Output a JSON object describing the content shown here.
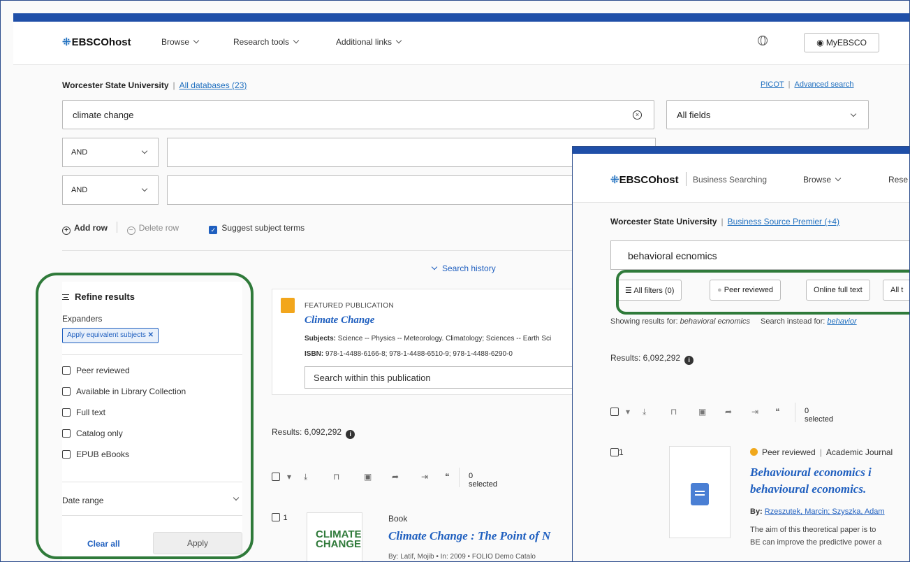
{
  "header": {
    "logo": "EBSCOhost",
    "nav": [
      "Browse",
      "Research tools",
      "Additional links"
    ],
    "myebsco": "MyEBSCO"
  },
  "search": {
    "institution": "Worcester State University",
    "databases": "All databases (23)",
    "picot": "PICOT",
    "advanced": "Advanced search",
    "query": "climate change",
    "field": "All fields",
    "op1": "AND",
    "op2": "AND",
    "add_row": "Add row",
    "delete_row": "Delete row",
    "suggest": "Suggest subject terms",
    "history": "Search history"
  },
  "sidebar": {
    "title": "Refine results",
    "expanders": "Expanders",
    "chip": "Apply equivalent subjects",
    "filters": [
      "Peer reviewed",
      "Available in Library Collection",
      "Full text",
      "Catalog only",
      "EPUB eBooks"
    ],
    "date_range": "Date range",
    "clear_all": "Clear all",
    "apply": "Apply"
  },
  "featured": {
    "tag": "FEATURED PUBLICATION",
    "title": "Climate Change",
    "subjects_label": "Subjects:",
    "subjects": "Science -- Physics -- Meteorology. Climatology; Sciences -- Earth Sci",
    "isbn_label": "ISBN:",
    "isbn": "978-1-4488-6166-8; 978-1-4488-6510-9; 978-1-4488-6290-0",
    "search_placeholder": "Search within this publication"
  },
  "results": {
    "count": "Results: 6,092,292",
    "selected": "0 selected",
    "item1": {
      "num": "1",
      "type": "Book",
      "title": "Climate Change : The Point of N",
      "by": "By: Latif, Mojib • In: 2009 • FOLIO Demo Catalo",
      "cover": "CLIMATE CHANGE"
    }
  },
  "overlay": {
    "logo": "EBSCOhost",
    "context": "Business Searching",
    "browse": "Browse",
    "rese": "Rese",
    "institution": "Worcester State University",
    "databases": "Business Source Premier (+4)",
    "query": "behavioral ecnomics",
    "pills": [
      "All filters (0)",
      "Peer reviewed",
      "Online full text",
      "All t"
    ],
    "showing_label": "Showing results for:",
    "showing_term": "behavioral ecnomics",
    "instead_label": "Search instead for:",
    "instead_term": "behavior",
    "results": "Results: 6,092,292",
    "selected": "0 selected",
    "item1": {
      "num": "1",
      "meta": "Peer reviewed",
      "type": "Academic Journal",
      "title1": "Behavioural economics i",
      "title2": "behavioural economics.",
      "by_label": "By:",
      "authors": "Rzeszutek, Marcin; Szyszka, Adam",
      "abstract1": "The aim of this theoretical paper is to",
      "abstract2": "BE can improve the predictive power a"
    }
  },
  "colors": {
    "brand_blue": "#1f4fa8",
    "link_blue": "#1f5fbf",
    "highlight_green": "#2f7a3a"
  }
}
